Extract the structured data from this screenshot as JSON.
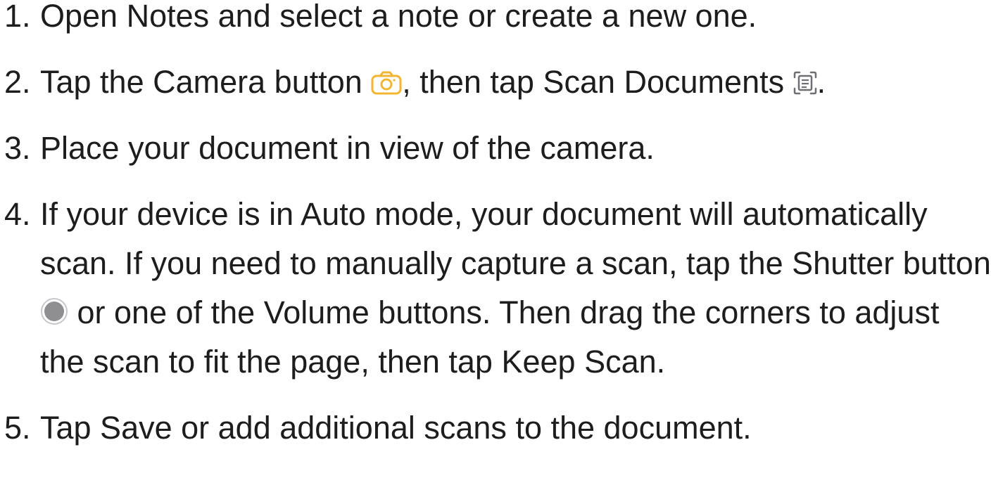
{
  "steps": [
    {
      "number": "1.",
      "parts": [
        "Open Notes and select a note or create a new one."
      ]
    },
    {
      "number": "2.",
      "parts": [
        "Tap the Camera button ",
        ", then tap Scan Documents ",
        "."
      ],
      "icons": [
        "camera-icon",
        "scan-documents-icon"
      ]
    },
    {
      "number": "3.",
      "parts": [
        "Place your document in view of the camera."
      ]
    },
    {
      "number": "4.",
      "parts": [
        "If your device is in Auto mode, your document will automatically scan. If you need to manually capture a scan, tap the Shutter button ",
        " or one of the Volume buttons. Then drag the corners to adjust the scan to fit the page, then tap Keep Scan."
      ],
      "icons": [
        "shutter-button-icon"
      ]
    },
    {
      "number": "5.",
      "parts": [
        "Tap Save or add additional scans to the document."
      ]
    }
  ],
  "colors": {
    "text": "#1d1d1f",
    "camera_icon": "#f2b632",
    "scan_icon": "#6e6e73",
    "shutter_icon": "#8e8e93"
  }
}
